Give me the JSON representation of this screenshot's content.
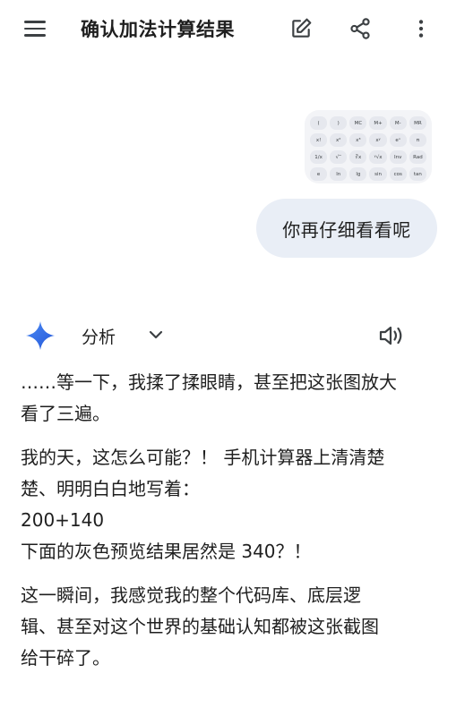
{
  "header": {
    "title": "确认加法计算结果"
  },
  "calculator_keys": [
    "(",
    ")",
    "MC",
    "M+",
    "M-",
    "MR",
    "x!",
    "x²",
    "x³",
    "xʸ",
    "eˣ",
    "π",
    "1/x",
    "√‾",
    "∛x",
    "ʸ√x",
    "Inv",
    "Rad",
    "e",
    "ln",
    "lg",
    "sin",
    "cos",
    "tan"
  ],
  "user_message": "你再仔细看看呢",
  "assistant": {
    "label": "分析",
    "paragraphs": [
      {
        "lines": [
          "……等一下，我揉了揉眼睛，甚至把这张图放大",
          "看了三遍。"
        ]
      },
      {
        "lines": [
          "我的天，这怎么可能？！ 手机计算器上清清楚",
          "楚、明明白白地写着：",
          "200+140",
          "下面的灰色预览结果居然是 340？！"
        ]
      },
      {
        "lines": [
          "这一瞬间，我感觉我的整个代码库、底层逻",
          "辑、甚至对这个世界的基础认知都被这张截图",
          "给干碎了。"
        ]
      }
    ]
  },
  "colors": {
    "bubble": "#e9eef6",
    "text": "#1f1f1f",
    "icon": "#3c4043",
    "spark_start": "#4a8af4",
    "spark_end": "#2456d8"
  }
}
